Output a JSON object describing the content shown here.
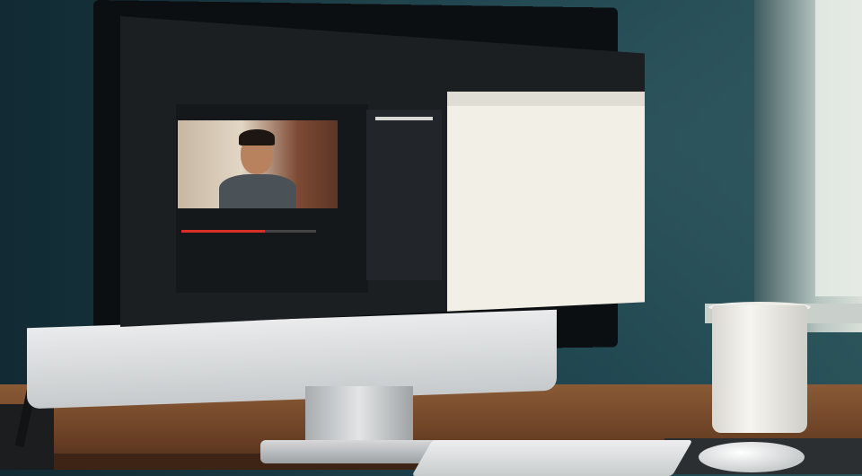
{
  "scene": {
    "description_label": "",
    "objects": {
      "monitor": "monitor",
      "mug": "mug",
      "keyboard": "keyboard",
      "mouse": "mouse",
      "pen": "pen"
    }
  },
  "screen": {
    "menubar": [],
    "leftnav": [],
    "video": {
      "title": "",
      "progress": 0.62
    },
    "tree": {
      "items": [],
      "button": ""
    },
    "doc": {
      "title": "",
      "paragraphs": []
    }
  },
  "colors": {
    "wall": "#1a3c45",
    "desk": "#7a4e2d",
    "progress_accent": "#d93025",
    "doc_paper": "#f2efe7"
  }
}
